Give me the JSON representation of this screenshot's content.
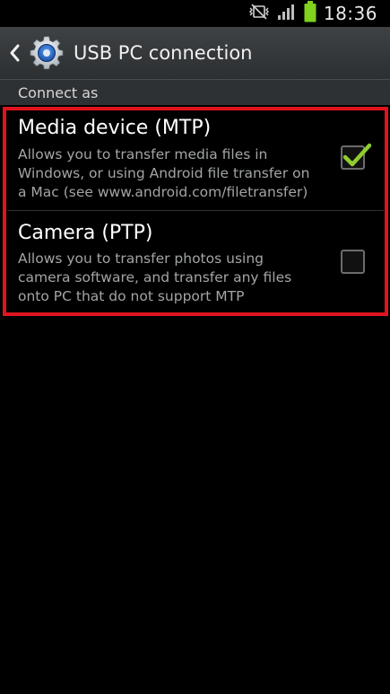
{
  "status_bar": {
    "time": "18:36",
    "icons": [
      "mute-vibrate-icon",
      "signal-icon",
      "battery-icon"
    ]
  },
  "action_bar": {
    "back_icon": "chevron-left-icon",
    "app_icon": "gear-icon",
    "title": "USB PC connection"
  },
  "section": {
    "label": "Connect as"
  },
  "options": [
    {
      "title": "Media device (MTP)",
      "description_lines": [
        "Allows you to transfer media files in",
        "Windows, or using Android file transfer on",
        "a Mac (see www.android.com/filetransfer)"
      ],
      "checked": true
    },
    {
      "title": "Camera (PTP)",
      "description_lines": [
        "Allows you to transfer photos using",
        "camera software, and transfer any files",
        "onto PC that do not support MTP"
      ],
      "checked": false
    }
  ],
  "colors": {
    "highlight": "#e0141e",
    "check": "#8fcc2e",
    "battery": "#7fd21d"
  }
}
